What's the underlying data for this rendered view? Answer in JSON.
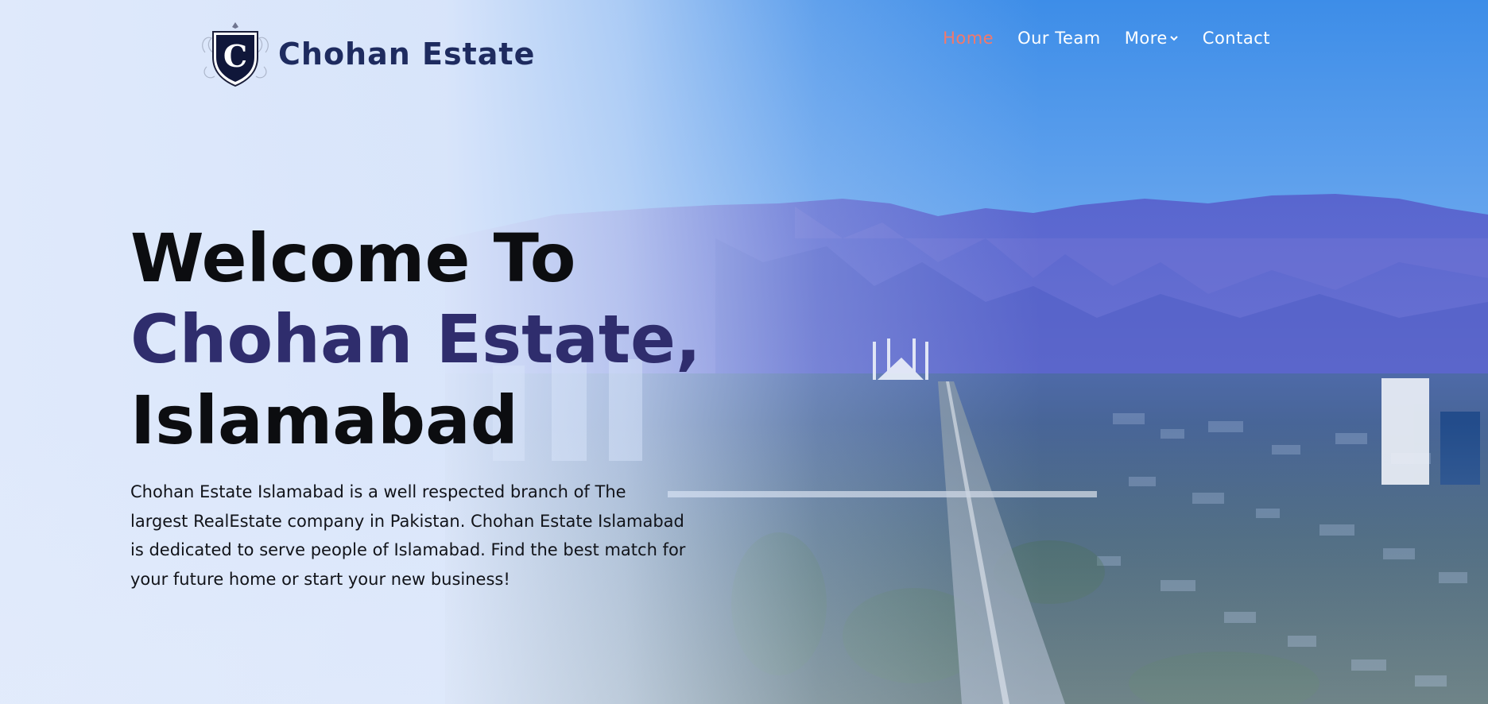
{
  "brand": {
    "logo_letter": "C",
    "name": "Chohan Estate"
  },
  "nav": {
    "items": [
      {
        "label": "Home",
        "active": true
      },
      {
        "label": "Our Team",
        "active": false
      },
      {
        "label": "More",
        "active": false,
        "icon": "chevron-down-icon"
      },
      {
        "label": "Contact",
        "active": false
      }
    ]
  },
  "hero": {
    "headline_line1": "Welcome To",
    "headline_line2": "Chohan Estate,",
    "headline_line3": "Islamabad",
    "intro": "Chohan Estate Islamabad is a well respected branch of The largest RealEstate company in Pakistan. Chohan Estate Islamabad is dedicated to serve people of Islamabad. Find the best match for your future home or start your new business!"
  },
  "colors": {
    "accent_nav": "#f3786a",
    "brand_navy": "#1e2b5f",
    "headline_accent": "#2f2d6d",
    "sky_top": "#3f8fe8"
  }
}
